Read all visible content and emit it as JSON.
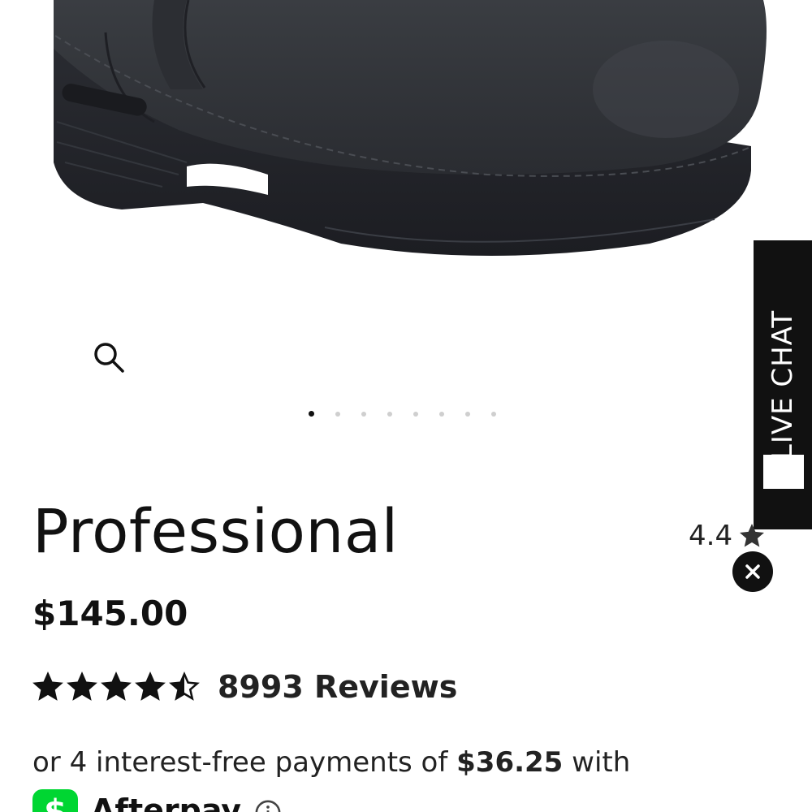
{
  "product": {
    "title": "Professional",
    "price": "$145.00",
    "rating_short": "4.4",
    "rating_value": 4.5,
    "reviews_label": "8993 Reviews"
  },
  "carousel": {
    "dot_count": 8,
    "active_index": 0
  },
  "live_chat": {
    "label": "LIVE CHAT"
  },
  "installments": {
    "prefix": "or 4 interest-free payments of ",
    "amount": "$36.25",
    "suffix": " with",
    "provider": "Afterpay"
  },
  "colors": {
    "text": "#111111",
    "afterpay_green": "#00d632",
    "live_chat_bg": "#111111"
  },
  "icons": {
    "zoom": "search-icon",
    "close": "close-icon",
    "chat": "chat-bubble-icon",
    "info": "info-icon",
    "cash": "dollar-icon"
  }
}
